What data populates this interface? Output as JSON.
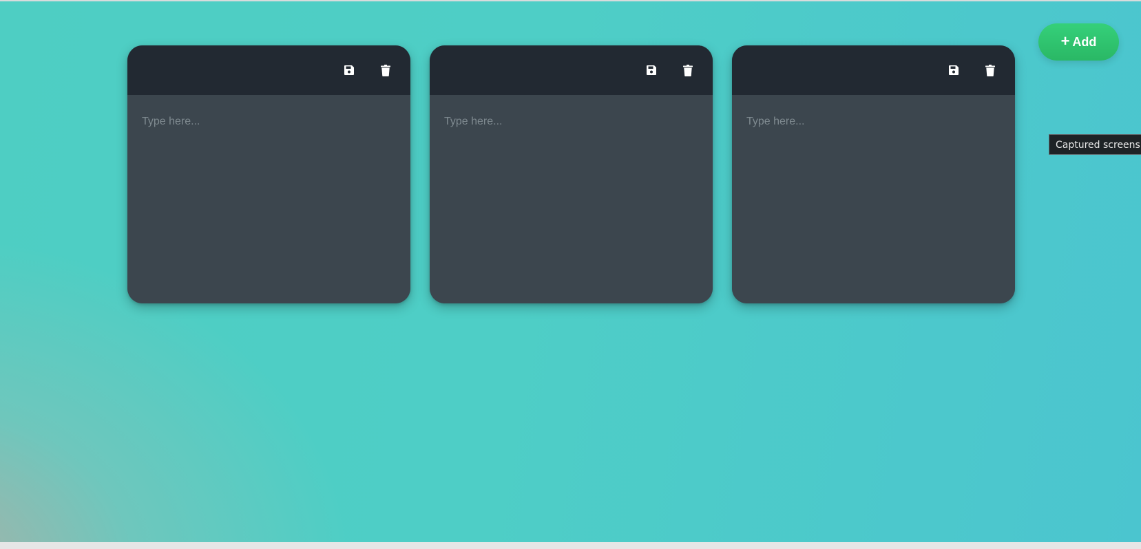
{
  "toolbar": {
    "add_label": "Add",
    "add_icon": "plus-icon"
  },
  "notes": [
    {
      "placeholder": "Type here...",
      "value": "",
      "save_icon": "floppy-disk-icon",
      "delete_icon": "trash-icon"
    },
    {
      "placeholder": "Type here...",
      "value": "",
      "save_icon": "floppy-disk-icon",
      "delete_icon": "trash-icon"
    },
    {
      "placeholder": "Type here...",
      "value": "",
      "save_icon": "floppy-disk-icon",
      "delete_icon": "trash-icon"
    }
  ],
  "tooltip": {
    "text": "Captured screensh"
  },
  "colors": {
    "background_start": "#4ecec3",
    "background_end": "#4bc5cf",
    "note_header": "#222932",
    "note_body": "#3c464e",
    "add_button": "#2ec872",
    "placeholder_text": "#7f8a90"
  }
}
